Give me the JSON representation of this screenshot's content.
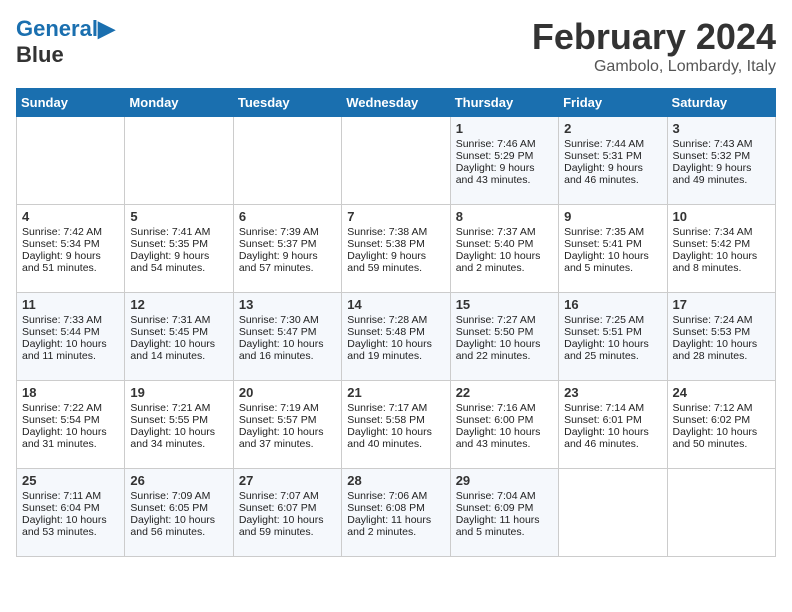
{
  "header": {
    "logo_line1": "General",
    "logo_line2": "Blue",
    "month_title": "February 2024",
    "location": "Gambolo, Lombardy, Italy"
  },
  "weekdays": [
    "Sunday",
    "Monday",
    "Tuesday",
    "Wednesday",
    "Thursday",
    "Friday",
    "Saturday"
  ],
  "weeks": [
    [
      {
        "day": "",
        "content": ""
      },
      {
        "day": "",
        "content": ""
      },
      {
        "day": "",
        "content": ""
      },
      {
        "day": "",
        "content": ""
      },
      {
        "day": "1",
        "content": "Sunrise: 7:46 AM\nSunset: 5:29 PM\nDaylight: 9 hours\nand 43 minutes."
      },
      {
        "day": "2",
        "content": "Sunrise: 7:44 AM\nSunset: 5:31 PM\nDaylight: 9 hours\nand 46 minutes."
      },
      {
        "day": "3",
        "content": "Sunrise: 7:43 AM\nSunset: 5:32 PM\nDaylight: 9 hours\nand 49 minutes."
      }
    ],
    [
      {
        "day": "4",
        "content": "Sunrise: 7:42 AM\nSunset: 5:34 PM\nDaylight: 9 hours\nand 51 minutes."
      },
      {
        "day": "5",
        "content": "Sunrise: 7:41 AM\nSunset: 5:35 PM\nDaylight: 9 hours\nand 54 minutes."
      },
      {
        "day": "6",
        "content": "Sunrise: 7:39 AM\nSunset: 5:37 PM\nDaylight: 9 hours\nand 57 minutes."
      },
      {
        "day": "7",
        "content": "Sunrise: 7:38 AM\nSunset: 5:38 PM\nDaylight: 9 hours\nand 59 minutes."
      },
      {
        "day": "8",
        "content": "Sunrise: 7:37 AM\nSunset: 5:40 PM\nDaylight: 10 hours\nand 2 minutes."
      },
      {
        "day": "9",
        "content": "Sunrise: 7:35 AM\nSunset: 5:41 PM\nDaylight: 10 hours\nand 5 minutes."
      },
      {
        "day": "10",
        "content": "Sunrise: 7:34 AM\nSunset: 5:42 PM\nDaylight: 10 hours\nand 8 minutes."
      }
    ],
    [
      {
        "day": "11",
        "content": "Sunrise: 7:33 AM\nSunset: 5:44 PM\nDaylight: 10 hours\nand 11 minutes."
      },
      {
        "day": "12",
        "content": "Sunrise: 7:31 AM\nSunset: 5:45 PM\nDaylight: 10 hours\nand 14 minutes."
      },
      {
        "day": "13",
        "content": "Sunrise: 7:30 AM\nSunset: 5:47 PM\nDaylight: 10 hours\nand 16 minutes."
      },
      {
        "day": "14",
        "content": "Sunrise: 7:28 AM\nSunset: 5:48 PM\nDaylight: 10 hours\nand 19 minutes."
      },
      {
        "day": "15",
        "content": "Sunrise: 7:27 AM\nSunset: 5:50 PM\nDaylight: 10 hours\nand 22 minutes."
      },
      {
        "day": "16",
        "content": "Sunrise: 7:25 AM\nSunset: 5:51 PM\nDaylight: 10 hours\nand 25 minutes."
      },
      {
        "day": "17",
        "content": "Sunrise: 7:24 AM\nSunset: 5:53 PM\nDaylight: 10 hours\nand 28 minutes."
      }
    ],
    [
      {
        "day": "18",
        "content": "Sunrise: 7:22 AM\nSunset: 5:54 PM\nDaylight: 10 hours\nand 31 minutes."
      },
      {
        "day": "19",
        "content": "Sunrise: 7:21 AM\nSunset: 5:55 PM\nDaylight: 10 hours\nand 34 minutes."
      },
      {
        "day": "20",
        "content": "Sunrise: 7:19 AM\nSunset: 5:57 PM\nDaylight: 10 hours\nand 37 minutes."
      },
      {
        "day": "21",
        "content": "Sunrise: 7:17 AM\nSunset: 5:58 PM\nDaylight: 10 hours\nand 40 minutes."
      },
      {
        "day": "22",
        "content": "Sunrise: 7:16 AM\nSunset: 6:00 PM\nDaylight: 10 hours\nand 43 minutes."
      },
      {
        "day": "23",
        "content": "Sunrise: 7:14 AM\nSunset: 6:01 PM\nDaylight: 10 hours\nand 46 minutes."
      },
      {
        "day": "24",
        "content": "Sunrise: 7:12 AM\nSunset: 6:02 PM\nDaylight: 10 hours\nand 50 minutes."
      }
    ],
    [
      {
        "day": "25",
        "content": "Sunrise: 7:11 AM\nSunset: 6:04 PM\nDaylight: 10 hours\nand 53 minutes."
      },
      {
        "day": "26",
        "content": "Sunrise: 7:09 AM\nSunset: 6:05 PM\nDaylight: 10 hours\nand 56 minutes."
      },
      {
        "day": "27",
        "content": "Sunrise: 7:07 AM\nSunset: 6:07 PM\nDaylight: 10 hours\nand 59 minutes."
      },
      {
        "day": "28",
        "content": "Sunrise: 7:06 AM\nSunset: 6:08 PM\nDaylight: 11 hours\nand 2 minutes."
      },
      {
        "day": "29",
        "content": "Sunrise: 7:04 AM\nSunset: 6:09 PM\nDaylight: 11 hours\nand 5 minutes."
      },
      {
        "day": "",
        "content": ""
      },
      {
        "day": "",
        "content": ""
      }
    ]
  ]
}
